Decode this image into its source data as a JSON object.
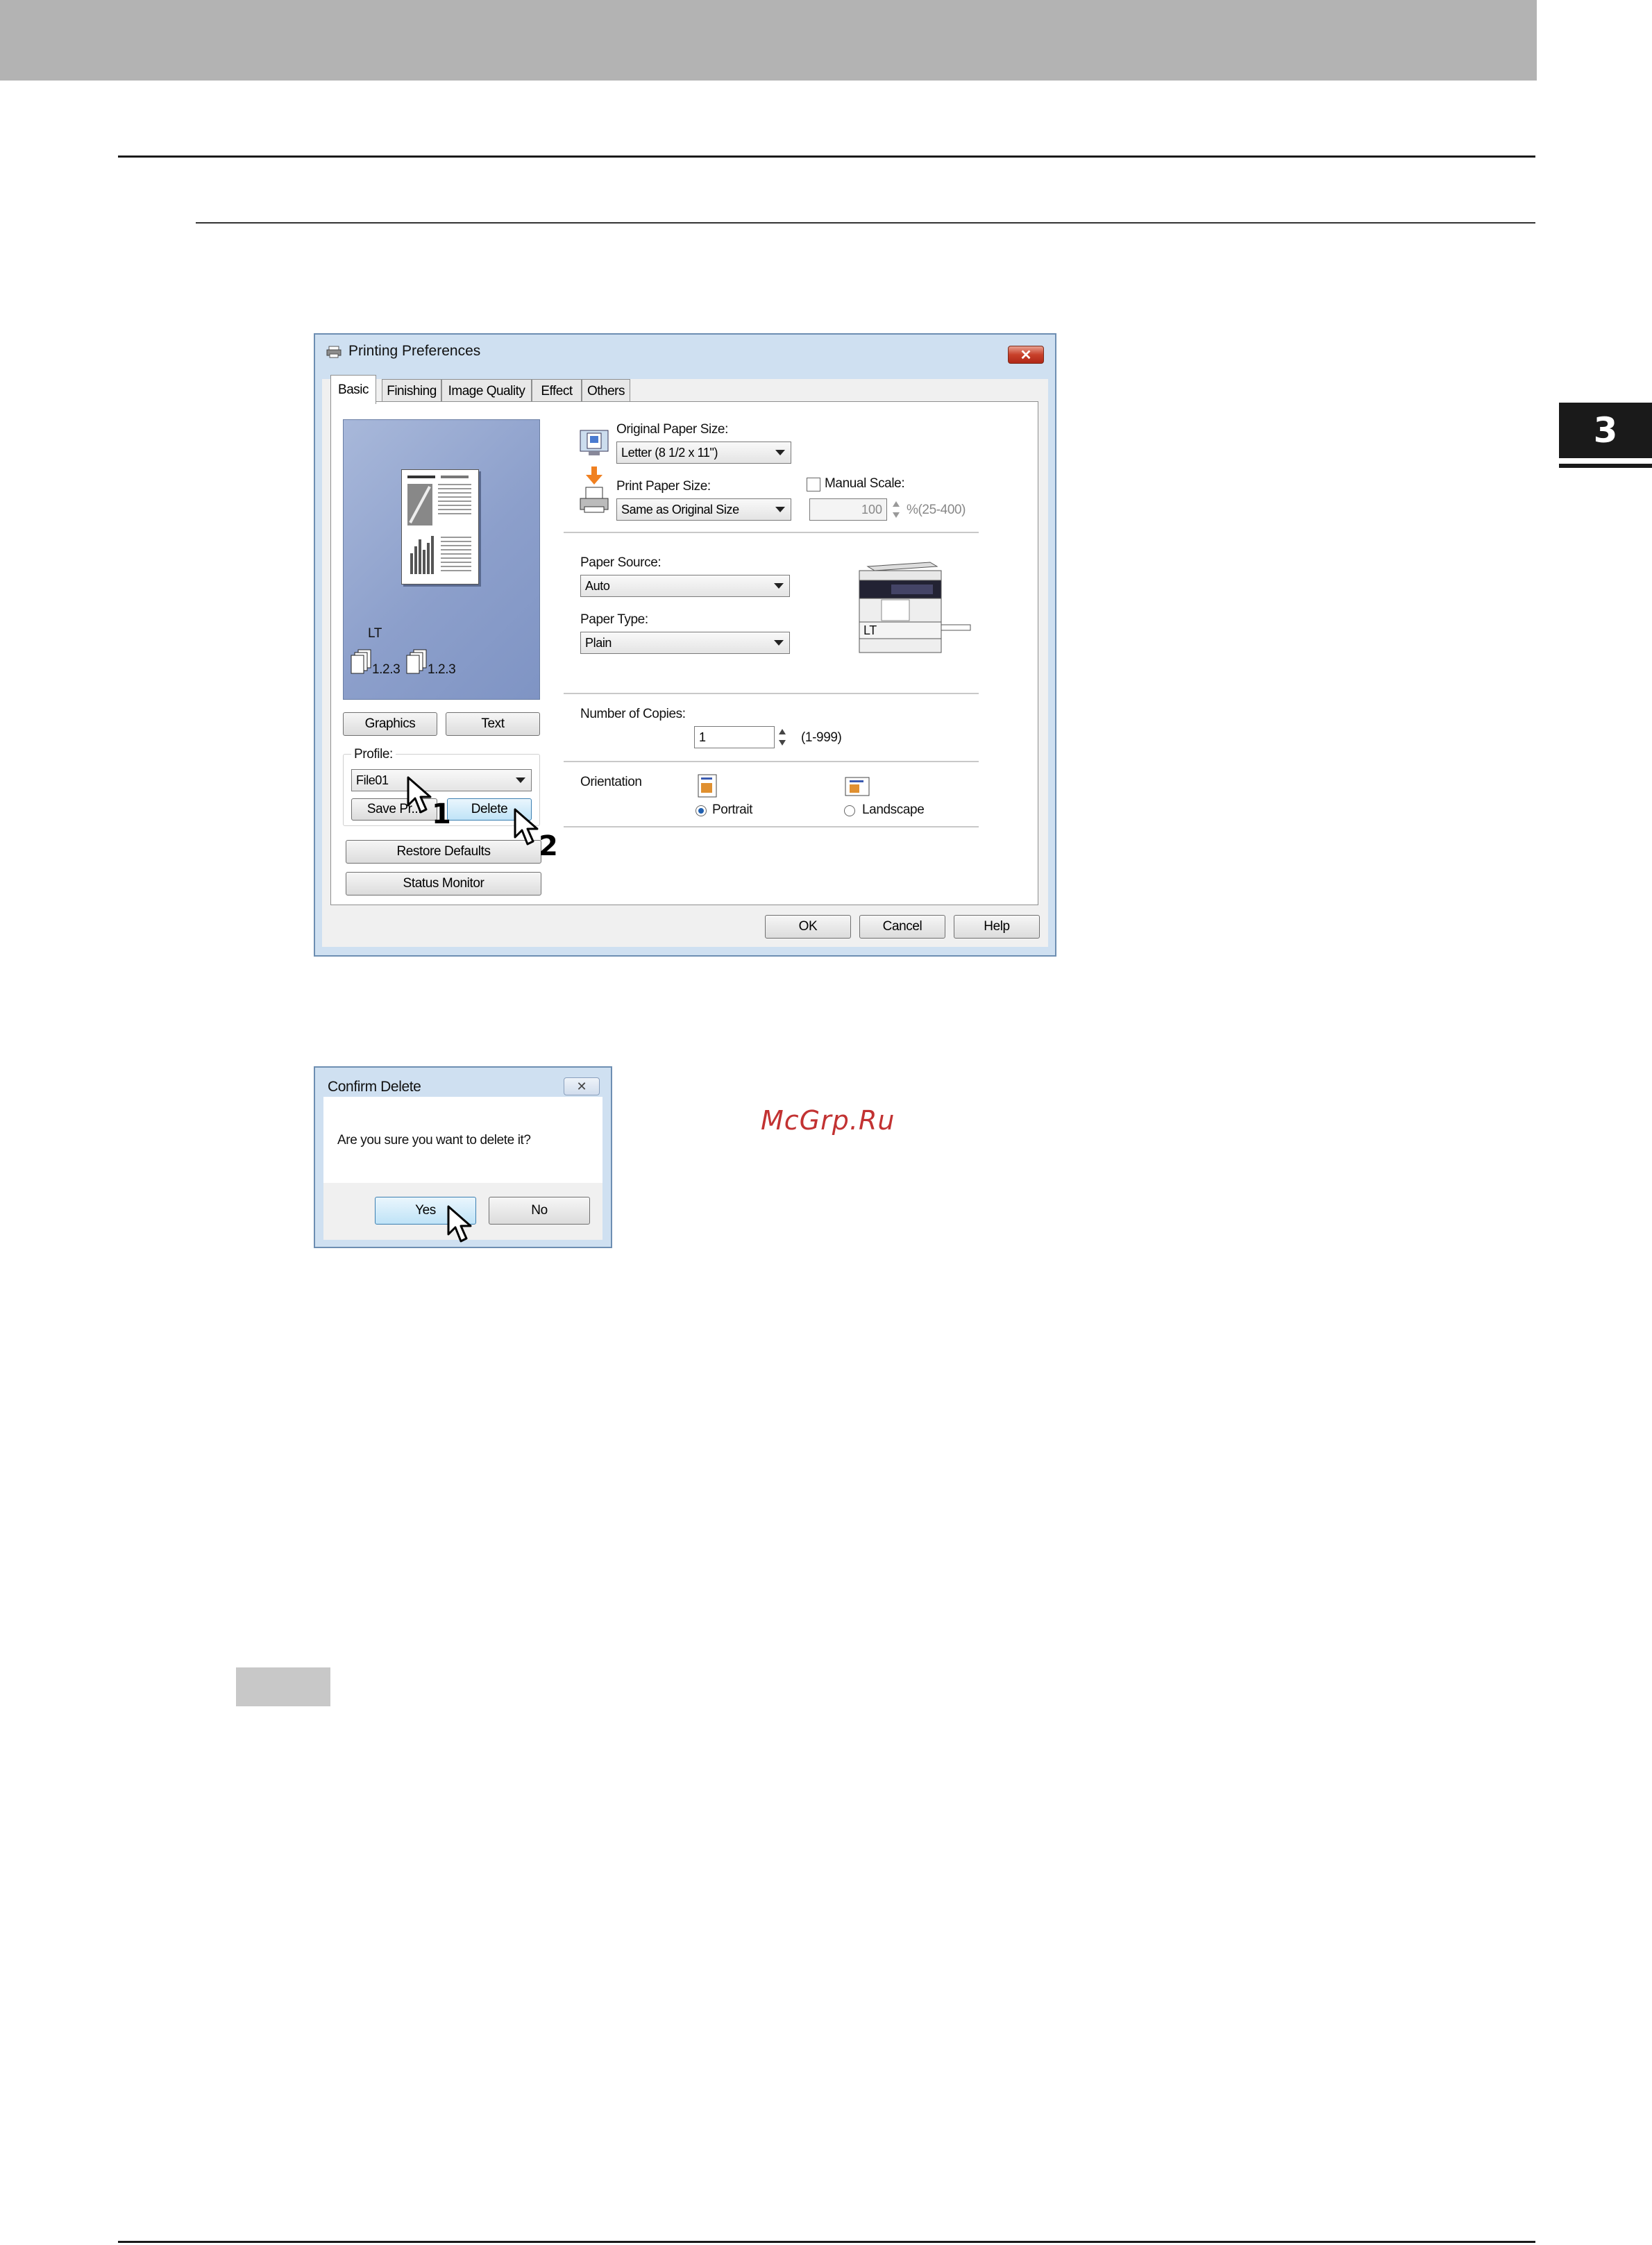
{
  "page": {
    "chapter_number": "3",
    "watermark": "McGrp.Ru"
  },
  "printing_preferences": {
    "title": "Printing Preferences",
    "close_glyph": "✕",
    "tabs": [
      "Basic",
      "Finishing",
      "Image Quality",
      "Effect",
      "Others"
    ],
    "active_tab": "Basic",
    "preview": {
      "paper_label": "LT",
      "collate_label_1": "1.2.3",
      "collate_label_2": "1.2.3"
    },
    "graphics_button": "Graphics",
    "text_button": "Text",
    "profile_label": "Profile:",
    "profile_value": "File01",
    "save_profile_button": "Save Pr...",
    "delete_button": "Delete",
    "restore_defaults_button": "Restore Defaults",
    "status_monitor_button": "Status Monitor",
    "original_paper_size_label": "Original Paper Size:",
    "original_paper_size_value": "Letter (8 1/2 x 11\")",
    "print_paper_size_label": "Print Paper Size:",
    "print_paper_size_value": "Same as Original Size",
    "manual_scale_label": "Manual Scale:",
    "manual_scale_value": "100",
    "manual_scale_range": "%(25-400)",
    "paper_source_label": "Paper Source:",
    "paper_source_value": "Auto",
    "paper_type_label": "Paper Type:",
    "paper_type_value": "Plain",
    "printer_tray_label": "LT",
    "copies_label": "Number of Copies:",
    "copies_value": "1",
    "copies_range": "(1-999)",
    "orientation_label": "Orientation",
    "portrait_label": "Portrait",
    "landscape_label": "Landscape",
    "orientation_selected": "Portrait",
    "ok_button": "OK",
    "cancel_button": "Cancel",
    "help_button": "Help",
    "step_1": "1",
    "step_2": "2"
  },
  "confirm_delete": {
    "title": "Confirm Delete",
    "message": "Are you sure you want to delete it?",
    "yes_button": "Yes",
    "no_button": "No",
    "close_glyph": "✕"
  }
}
